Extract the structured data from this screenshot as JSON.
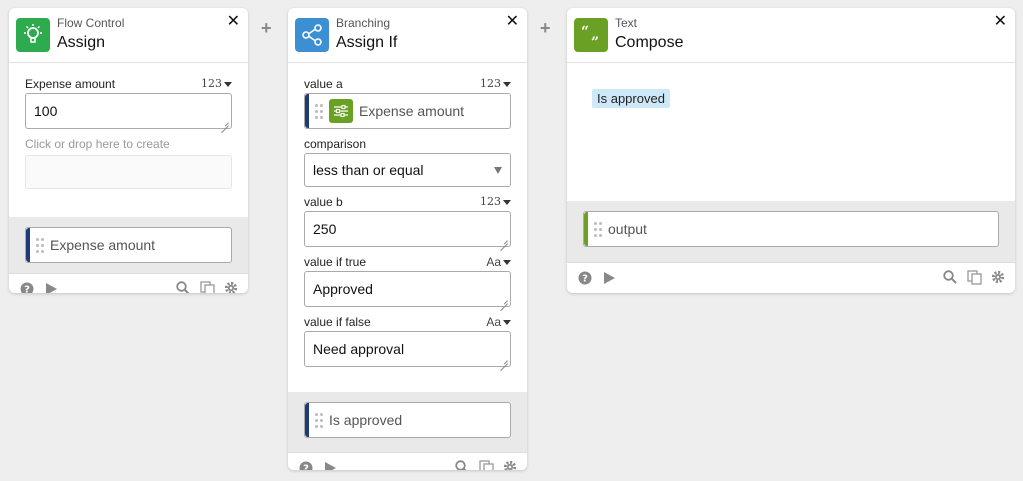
{
  "colors": {
    "flow_control": "#2eaa4f",
    "branching": "#3d8fd4",
    "text": "#6aa024",
    "pill_bar_blue": "#1f3a7a",
    "pill_bar_green": "#6aa024",
    "tag_bg": "#cde9f7"
  },
  "cards": [
    {
      "category": "Flow Control",
      "title": "Assign",
      "icon": "lightbulb-icon",
      "field_label": "Expense amount",
      "type": "123",
      "value": "100",
      "hint": "Click or drop here to create",
      "output": "Expense amount"
    },
    {
      "category": "Branching",
      "title": "Assign If",
      "icon": "share-icon",
      "value_a_label": "value a",
      "value_a_type": "123",
      "value_a_pill": "Expense amount",
      "comparison_label": "comparison",
      "comparison_value": "less than or equal",
      "value_b_label": "value b",
      "value_b_type": "123",
      "value_b": "250",
      "if_true_label": "value if true",
      "if_true_type": "Aa",
      "if_true_value": "Approved",
      "if_false_label": "value if false",
      "if_false_type": "Aa",
      "if_false_value": "Need approval",
      "output": "Is approved"
    },
    {
      "category": "Text",
      "title": "Compose",
      "icon": "quote-icon",
      "tag": "Is approved",
      "output": "output"
    }
  ],
  "close_glyph": "✕",
  "plus_glyph": "+"
}
